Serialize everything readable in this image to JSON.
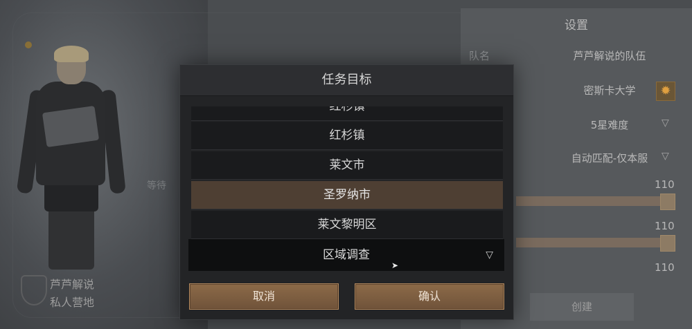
{
  "background": {
    "player_name": "芦芦解说",
    "camp_name": "私人营地",
    "side_text": "等待"
  },
  "settings": {
    "title": "设置",
    "team_label": "队名",
    "team_value": "芦芦解说的队伍",
    "map_value": "密斯卡大学",
    "difficulty_value": "5星难度",
    "match_value": "自动匹配-仅本服",
    "slider_values": [
      "110",
      "110",
      "110"
    ],
    "create_label": "创建"
  },
  "modal": {
    "title": "任务目标",
    "items": [
      {
        "label": "红杉镇"
      },
      {
        "label": "红杉镇"
      },
      {
        "label": "莱文市"
      },
      {
        "label": "圣罗纳市",
        "selected": true
      },
      {
        "label": "莱文黎明区"
      }
    ],
    "dropdown_value": "区域调查",
    "cancel_label": "取消",
    "confirm_label": "确认"
  },
  "colors": {
    "accent": "#8c6a48",
    "selected_row": "#4e3f33"
  },
  "icons": {
    "dropdown": "chevron-down-icon",
    "gear": "gear-icon",
    "cursor": "mouse-cursor-icon"
  }
}
